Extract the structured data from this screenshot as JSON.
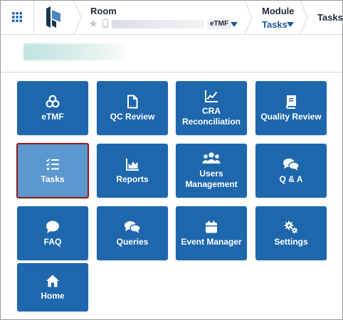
{
  "header": {
    "room_label": "Room",
    "room_badge": "eTMF",
    "module_label": "Module",
    "module_value": "Tasks",
    "crumb_current": "Tasks"
  },
  "tiles": [
    {
      "label": "eTMF",
      "icon": "etmf-icon"
    },
    {
      "label": "QC Review",
      "icon": "document-icon"
    },
    {
      "label": "CRA\nReconciliation",
      "icon": "chart-line-icon"
    },
    {
      "label": "Quality Review",
      "icon": "book-icon"
    },
    {
      "label": "Tasks",
      "icon": "tasks-list-icon",
      "active": true
    },
    {
      "label": "Reports",
      "icon": "area-chart-icon"
    },
    {
      "label": "Users\nManagement",
      "icon": "users-icon"
    },
    {
      "label": "Q & A",
      "icon": "comments-icon"
    },
    {
      "label": "FAQ",
      "icon": "comment-icon"
    },
    {
      "label": "Queries",
      "icon": "comments-icon"
    },
    {
      "label": "Event Manager",
      "icon": "calendar-icon"
    },
    {
      "label": "Settings",
      "icon": "gears-icon"
    },
    {
      "label": "Home",
      "icon": "home-icon"
    }
  ],
  "colors": {
    "tile": "#1e67ad",
    "tile_active": "#5c97cf",
    "active_border": "#8c1c1c",
    "accent": "#1e5a96"
  }
}
